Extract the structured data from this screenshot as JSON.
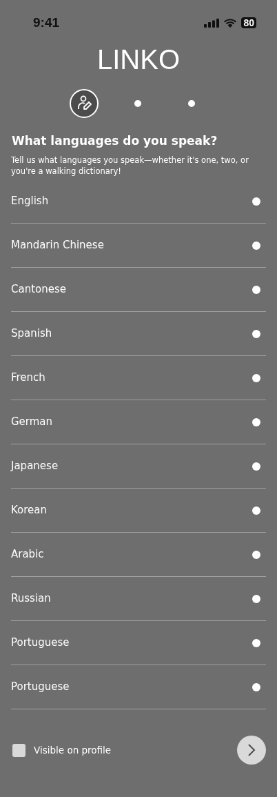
{
  "status_bar": {
    "time": "9:41",
    "battery": "80"
  },
  "app_title": "LINKO",
  "steps": [
    {
      "selected": true
    },
    {
      "selected": false
    },
    {
      "selected": false
    }
  ],
  "heading": "What languages do you speak?",
  "subtitle": "Tell us what languages you speak—whether it's one, two, or you're a walking dictionary!",
  "languages": [
    {
      "label": "English",
      "selected": false
    },
    {
      "label": "Mandarin Chinese",
      "selected": false
    },
    {
      "label": "Cantonese",
      "selected": false
    },
    {
      "label": "Spanish",
      "selected": false
    },
    {
      "label": "French",
      "selected": false
    },
    {
      "label": "German",
      "selected": false
    },
    {
      "label": "Japanese",
      "selected": false
    },
    {
      "label": "Korean",
      "selected": false
    },
    {
      "label": "Arabic",
      "selected": false
    },
    {
      "label": "Russian",
      "selected": false
    },
    {
      "label": "Portuguese",
      "selected": false
    },
    {
      "label": "Portuguese",
      "selected": false
    }
  ],
  "visible_on_profile": {
    "label": "Visible on profile",
    "checked": false
  }
}
